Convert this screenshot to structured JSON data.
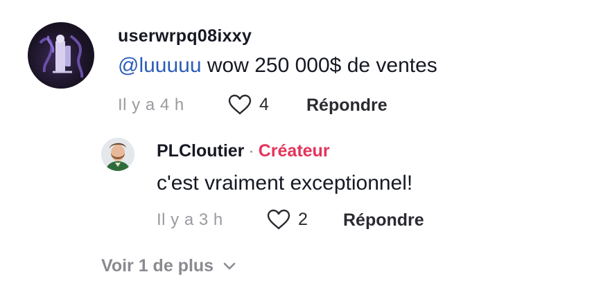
{
  "comment": {
    "username": "userwrpq08ixxy",
    "mention": "@luuuuu",
    "text": " wow 250 000$ de ventes",
    "time": "Il y a 4 h",
    "likes": "4",
    "reply_label": "Répondre"
  },
  "reply": {
    "username": "PLCloutier",
    "separator": "·",
    "badge": "Créateur",
    "text": "c'est vraiment exceptionnel!",
    "time": "Il y a 3 h",
    "likes": "2",
    "reply_label": "Répondre"
  },
  "more_replies": {
    "label": "Voir 1 de plus"
  },
  "icons": {
    "like": "heart-outline-icon",
    "expand": "chevron-down-icon"
  },
  "colors": {
    "mention": "#2b5db9",
    "creator_badge": "#e5335a",
    "muted": "#9a9aa0"
  }
}
